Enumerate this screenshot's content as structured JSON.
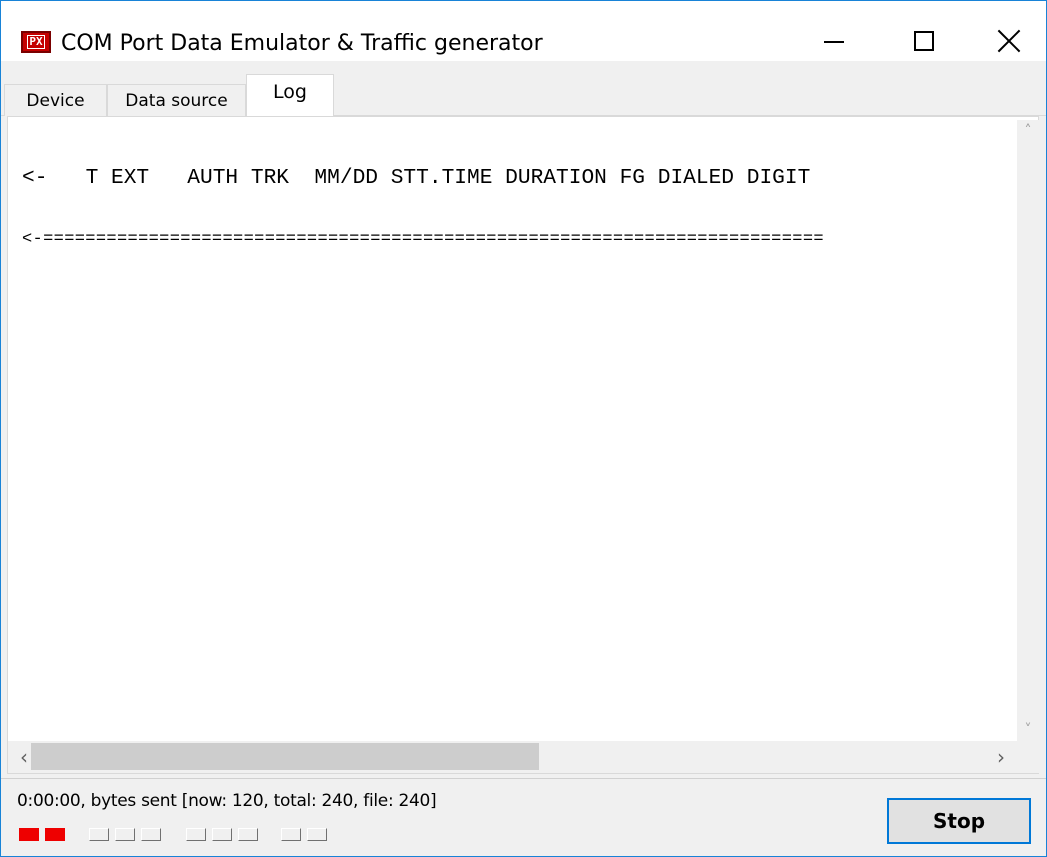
{
  "window": {
    "title": "COM Port Data Emulator & Traffic generator",
    "icon": {
      "name": "app-icon",
      "glyph": "PX",
      "color": "#c40000"
    },
    "controls": {
      "minimize": "minimize-icon",
      "maximize": "maximize-icon",
      "close": "close-icon"
    }
  },
  "tabs": [
    {
      "label": "Device",
      "active": false
    },
    {
      "label": "Data source",
      "active": false
    },
    {
      "label": "Log",
      "active": true
    }
  ],
  "log": {
    "lines": [
      "<-   T EXT   AUTH TRK  MM/DD STT.TIME DURATION FG DIALED DIGIT",
      "<-=========================================================================="
    ]
  },
  "scrollbars": {
    "vertical": {
      "up": "chevron-up-icon",
      "down": "chevron-down-icon"
    },
    "horizontal": {
      "left": "chevron-left-icon",
      "right": "chevron-right-icon"
    }
  },
  "status": {
    "text": "0:00:00, bytes sent [now: 120, total: 240, file: 240]",
    "indicators": [
      true,
      true,
      false,
      false,
      false,
      false,
      false,
      false,
      false,
      false,
      false,
      false
    ],
    "indicator_on_color": "#ee0000"
  },
  "buttons": {
    "stop_label": "Stop"
  }
}
